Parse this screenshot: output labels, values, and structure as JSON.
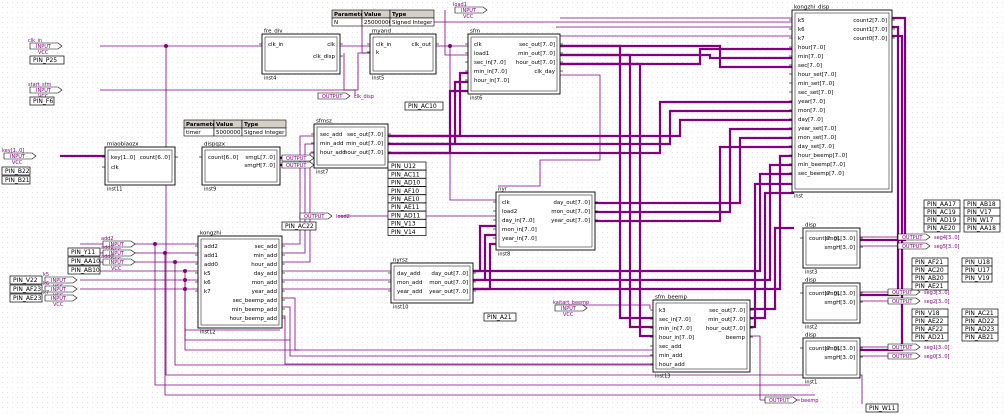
{
  "colors": {
    "wire": "#800080",
    "bus": "#800080",
    "grid": "#c8c8c8",
    "block": "#000000",
    "bg": "#ffffff"
  },
  "tables": [
    {
      "id": "param-table-fre-div",
      "header": [
        "Parameter",
        "Value",
        "Type"
      ],
      "row": [
        "N",
        "25000000",
        "Signed Integer"
      ]
    },
    {
      "id": "param-table-dispqzx",
      "header": [
        "Parameter",
        "Value",
        "Type"
      ],
      "row": [
        "timer",
        "5000000",
        "Signed Integer"
      ]
    }
  ],
  "blocks": [
    {
      "id": "fre_div",
      "title": "fre_div",
      "inst": "inst4",
      "ports_l": [
        "clk_in"
      ],
      "ports_r": [
        "clk",
        "clk_disp"
      ]
    },
    {
      "id": "myand",
      "title": "myand",
      "inst": "inst5",
      "ports_l": [
        "clk_in",
        "k"
      ],
      "ports_r": [
        "clk_out"
      ]
    },
    {
      "id": "sfm",
      "title": "sfm",
      "inst": "inst6",
      "ports_l": [
        "clk",
        "load1",
        "sec_in[7..0]",
        "min_in[7..0]",
        "hour_in[7..0]"
      ],
      "ports_r": [
        "sec_out[7..0]",
        "min_out[7..0]",
        "hour_out[7..0]",
        "clk_day"
      ]
    },
    {
      "id": "miaobiaozx",
      "title": "miaobiaozx",
      "inst": "inst11",
      "ports_l": [
        "key[1..0]",
        "clk"
      ],
      "ports_r": [
        "count[6..0]"
      ]
    },
    {
      "id": "dispqzx",
      "title": "dispqzx",
      "inst": "inst9",
      "ports_l": [
        "count[6..0]"
      ],
      "ports_r": [
        "smgL[7..0]",
        "smgH[7..0]"
      ]
    },
    {
      "id": "sfmsz",
      "title": "sfmsz",
      "inst": "inst7",
      "ports_l": [
        "sec_add",
        "min_add",
        "hour_add"
      ],
      "ports_r": [
        "sec_out[7..0]",
        "min_out[7..0]",
        "hour_out[7..0]"
      ]
    },
    {
      "id": "nyr",
      "title": "nyr",
      "inst": "inst8",
      "ports_l": [
        "clk",
        "load2",
        "day_in[7..0]",
        "mon_in[7..0]",
        "year_in[7..0]"
      ],
      "ports_r": [
        "day_out[7..0]",
        "mon_out[7..0]",
        "year_out[7..0]"
      ]
    },
    {
      "id": "nyrsz",
      "title": "nyrsz",
      "inst": "inst10",
      "ports_l": [
        "day_add",
        "mon_add",
        "year_add"
      ],
      "ports_r": [
        "day_out[7..0]",
        "mon_out[7..0]",
        "year_out[7..0]"
      ]
    },
    {
      "id": "kongzhi",
      "title": "kongzhi",
      "inst": "inst12",
      "ports_l": [
        "add2",
        "add1",
        "add0",
        "k5",
        "k6",
        "k7"
      ],
      "ports_r": [
        "sec_add",
        "min_add",
        "hour_add",
        "day_add",
        "mon_add",
        "year_add",
        "sec_beemp_add",
        "min_beemp_add",
        "hour_beemp_add"
      ]
    },
    {
      "id": "sfm_beemp",
      "title": "sfm_beemp",
      "inst": "inst13",
      "ports_l": [
        "k3",
        "sec_in[7..0]",
        "min_in[7..0]",
        "hour_in[7..0]",
        "sec_add",
        "min_add",
        "hour_add"
      ],
      "ports_r": [
        "sec_out[7..0]",
        "min_out[7..0]",
        "hour_out[7..0]",
        "beemp"
      ]
    },
    {
      "id": "kongzhi_disp",
      "title": "kongzhi_disp",
      "inst": "inst",
      "ports_l": [
        "k5",
        "k6",
        "k7",
        "hour[7..0]",
        "min[7..0]",
        "sec[7..0]",
        "hour_set[7..0]",
        "min_set[7..0]",
        "sec_set[7..0]",
        "year[7..0]",
        "mon[7..0]",
        "day[7..0]",
        "year_set[7..0]",
        "mon_set[7..0]",
        "day_set[7..0]",
        "hour_beemp[7..0]",
        "min_beemp[7..0]",
        "sec_beemp[7..0]"
      ],
      "ports_r": [
        "count2[7..0]",
        "count1[7..0]",
        "count0[7..0]"
      ]
    },
    {
      "id": "disp3",
      "title": "disp",
      "inst": "inst3",
      "ports_l": [
        "count[7..0]"
      ],
      "ports_r": [
        "smgL[3..0]",
        "smgH[3..0]"
      ]
    },
    {
      "id": "disp2",
      "title": "disp",
      "inst": "inst2",
      "ports_l": [
        "count[7..0]"
      ],
      "ports_r": [
        "smgL[3..0]",
        "smgH[3..0]"
      ]
    },
    {
      "id": "disp1",
      "title": "disp",
      "inst": "inst1",
      "ports_l": [
        "count[7..0]"
      ],
      "ports_r": [
        "smgL[3..0]",
        "smgH[3..0]"
      ]
    }
  ],
  "pins_in": [
    {
      "id": "clk_in",
      "name": "clk_in",
      "dir": "INPUT",
      "vcc": "VCC",
      "pin": "PIN_P25"
    },
    {
      "id": "start_sfm",
      "name": "start_sfm",
      "dir": "INPUT",
      "vcc": "VCC",
      "pin": "PIN_F6"
    },
    {
      "id": "key",
      "name": "key[1..0]",
      "dir": "INPUT",
      "vcc": "VCC",
      "pins": [
        "PIN_B22",
        "PIN_B21"
      ]
    },
    {
      "id": "add2",
      "name": "add2",
      "dir": "INPUT",
      "vcc": "VCC",
      "pin": "PIN_Y11"
    },
    {
      "id": "add1",
      "name": "add1",
      "dir": "INPUT",
      "vcc": "VCC",
      "pin": "PIN_AA10"
    },
    {
      "id": "add0",
      "name": "add0",
      "dir": "INPUT",
      "vcc": "VCC",
      "pin": "PIN_AB10"
    },
    {
      "id": "k5",
      "name": "k5",
      "dir": "INPUT",
      "vcc": "VCC",
      "pin": "PIN_V22"
    },
    {
      "id": "k6",
      "name": "k6",
      "dir": "INPUT",
      "vcc": "VCC",
      "pin": "PIN_AF23"
    },
    {
      "id": "k7",
      "name": "k7",
      "dir": "INPUT",
      "vcc": "VCC",
      "pin": "PIN_AE23"
    },
    {
      "id": "load1",
      "name": "load1",
      "dir": "INPUT",
      "vcc": "VCC",
      "pin": ""
    },
    {
      "id": "kaitart_beemp",
      "name": "kaitart_beemp",
      "dir": "INPUT",
      "vcc": "VCC",
      "pin": "PIN_A21"
    }
  ],
  "pins_out": [
    {
      "id": "clk_disp",
      "name": "clk_disp",
      "dir": "OUTPUT",
      "pin": "PIN_AC10"
    },
    {
      "id": "load2",
      "name": "load2",
      "dir": "OUTPUT",
      "pin": "PIN_AC22"
    },
    {
      "id": "beemp",
      "name": "beemp",
      "dir": "OUTPUT",
      "pin": "PIN_W11"
    },
    {
      "id": "seg4",
      "name": "seg4[3..0]",
      "dir": "OUTPUT"
    },
    {
      "id": "seg5",
      "name": "seg5[3..0]",
      "dir": "OUTPUT"
    },
    {
      "id": "seg3",
      "name": "seg3[3..0]",
      "dir": "OUTPUT"
    },
    {
      "id": "seg2",
      "name": "seg2[3..0]",
      "dir": "OUTPUT"
    },
    {
      "id": "seg1",
      "name": "seg1[3..0]",
      "dir": "OUTPUT"
    },
    {
      "id": "seg0",
      "name": "seg0[3..0]",
      "dir": "OUTPUT"
    },
    {
      "id": "smg_out_a",
      "name": "",
      "dir": "OUTPUT"
    },
    {
      "id": "smg_out_b",
      "name": "",
      "dir": "OUTPUT"
    }
  ],
  "pin_lists": {
    "dispqzx_pins": [
      "PIN_U12",
      "PIN_AC11",
      "PIN_AD10",
      "PIN_AF10",
      "PIN_AE10",
      "PIN_AE11",
      "PIN_AD11",
      "PIN_V13",
      "PIN_V14"
    ],
    "seg4_5_left": [
      "PIN_AA17",
      "PIN_AC19",
      "PIN_AD19",
      "PIN_AE20"
    ],
    "seg4_5_right": [
      "PIN_AB18",
      "PIN_V17",
      "PIN_W17",
      "PIN_AA18"
    ],
    "seg2_3_left": [
      "PIN_AF21",
      "PIN_AC20",
      "PIN_AB20",
      "PIN_AE21"
    ],
    "seg2_3_right": [
      "PIN_U18",
      "PIN_U17",
      "PIN_V19"
    ],
    "seg0_1_left": [
      "PIN_V18",
      "PIN_AE22",
      "PIN_AF22",
      "PIN_AD21"
    ],
    "seg0_1_right": [
      "PIN_AC21",
      "PIN_AD22",
      "PIN_AD23",
      "PIN_AB21"
    ]
  }
}
